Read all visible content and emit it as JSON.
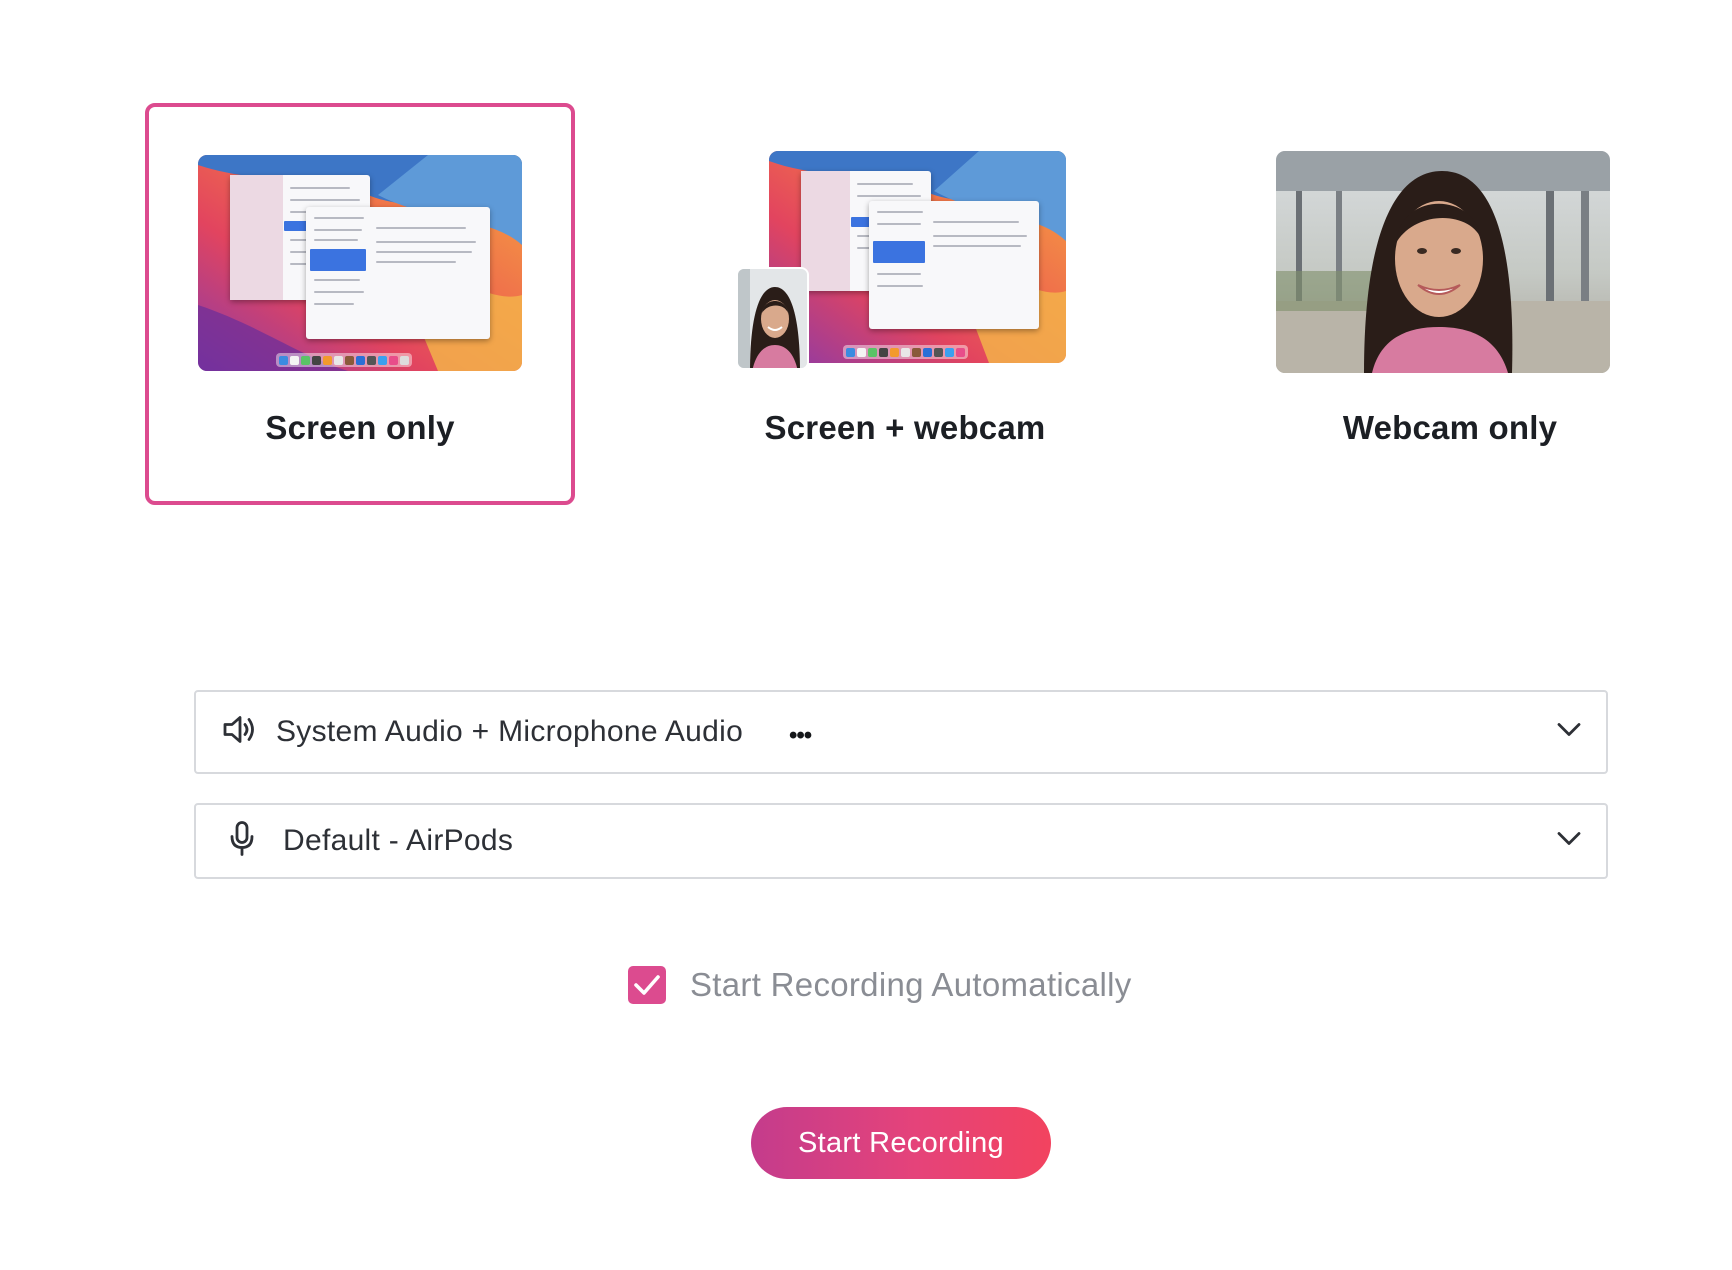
{
  "modes": [
    {
      "label": "Screen only",
      "selected": true,
      "thumbnail": "screen-preview"
    },
    {
      "label": "Screen + webcam",
      "selected": false,
      "thumbnail": "screen-webcam-preview"
    },
    {
      "label": "Webcam only",
      "selected": false,
      "thumbnail": "webcam-preview"
    }
  ],
  "audio_select": {
    "icon": "speaker-icon",
    "value": "System Audio + Microphone Audio",
    "overflow_mark": "•••"
  },
  "mic_select": {
    "icon": "microphone-icon",
    "value": "Default - AirPods"
  },
  "auto_start": {
    "label": "Start Recording Automatically",
    "checked": true
  },
  "start_button": {
    "label": "Start Recording"
  },
  "colors": {
    "accent": "#dc4b8f",
    "button_gradient_start": "#c43c8c",
    "button_gradient_end": "#f2435f",
    "border": "#d7d9dd"
  }
}
